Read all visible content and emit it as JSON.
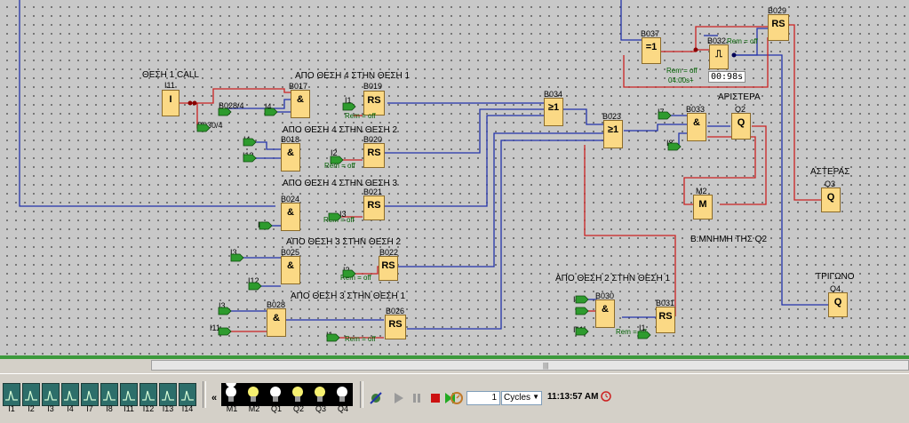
{
  "diagram": {
    "titles": {
      "call": "ΘΕΣΗ 1 CALL",
      "r1": "ΑΠΟ ΘΕΣΗ 4 ΣΤΗΝ ΘΕΣΗ 1",
      "r2": "ΑΠΟ ΘΕΣΗ 4 ΣΤΗΝ ΘΕΣΗ 2",
      "r3": "ΑΠΟ ΘΕΣΗ 4 ΣΤΗΝ ΘΕΣΗ 3",
      "r4": "ΑΠΟ ΘΕΣΗ 3 ΣΤΗΝ ΘΕΣΗ 2",
      "r5": "ΑΠΟ ΘΕΣΗ 3 ΣΤΗΝ ΘΕΣΗ 1",
      "r6": "ΑΠΟ ΘΕΣΗ 2 ΣΤΗΝ ΘΕΣΗ 1",
      "aristera": "ΑΡΙΣΤΕΡΑ",
      "asteras": "ΑΣΤΕΡΑΣ",
      "trigono": "ΤΡΙΓΩΝΟ",
      "mnimi": "Β:ΜΝΗΜΗ ΤΗΣ Q2"
    },
    "blocks": {
      "I11": {
        "id": "I11",
        "text": "I"
      },
      "B017": {
        "id": "B017",
        "text": "&"
      },
      "B019": {
        "id": "B019",
        "text": "RS"
      },
      "B018": {
        "id": "B018",
        "text": "&"
      },
      "B020": {
        "id": "B020",
        "text": "RS"
      },
      "B024": {
        "id": "B024",
        "text": "&"
      },
      "B021": {
        "id": "B021",
        "text": "RS"
      },
      "B025": {
        "id": "B025",
        "text": "&"
      },
      "B022": {
        "id": "B022",
        "text": "RS"
      },
      "B028": {
        "id": "B028",
        "text": "&"
      },
      "B026": {
        "id": "B026",
        "text": "RS"
      },
      "B034": {
        "id": "B034",
        "text": "≥1"
      },
      "B023": {
        "id": "B023",
        "text": "≥1"
      },
      "B037": {
        "id": "B037",
        "text": "=1"
      },
      "B032": {
        "id": "B032",
        "text": "⎍"
      },
      "B029": {
        "id": "B029",
        "text": "RS"
      },
      "B033": {
        "id": "B033",
        "text": "&"
      },
      "Q2": {
        "id": "Q2",
        "text": "Q"
      },
      "M2": {
        "id": "M2",
        "text": "M"
      },
      "Q3": {
        "id": "Q3",
        "text": "Q"
      },
      "Q4": {
        "id": "Q4",
        "text": "Q"
      },
      "B030": {
        "id": "B030",
        "text": "&"
      },
      "B031": {
        "id": "B031",
        "text": "RS"
      }
    },
    "inputs": {
      "B028_4": "B028/4",
      "B030_4": "B030/4",
      "i4a": "I4",
      "i1a": "I1",
      "i4b": "I4",
      "i12a": "I12",
      "i2a": "I2",
      "i13": "I13",
      "i3a": "I3",
      "i3b": "I3",
      "i12b": "I12",
      "i2b": "I2",
      "i3c": "I3",
      "i11a": "I11",
      "i1b": "I1",
      "i7": "I7",
      "i8": "I8",
      "i2c": "I2",
      "i11b": "I11",
      "i1c": "I1"
    },
    "rem_text": "Rem = off",
    "rem_timer": "Rem = off",
    "timer_on": "04:00s+",
    "timer_value": "00:98s"
  },
  "toolbar": {
    "inputs": [
      "I1",
      "I2",
      "I3",
      "I4",
      "I7",
      "I8",
      "I11",
      "I12",
      "I13",
      "I14"
    ],
    "collapse": "«",
    "outputs": [
      {
        "label": "M1",
        "state": "off"
      },
      {
        "label": "M2",
        "state": "on"
      },
      {
        "label": "Q1",
        "state": "off"
      },
      {
        "label": "Q2",
        "state": "on"
      },
      {
        "label": "Q3",
        "state": "on"
      },
      {
        "label": "Q4",
        "state": "off"
      }
    ],
    "cycles_value": "1",
    "cycles_unit": "Cycles",
    "time": "11:13:57 AM"
  },
  "colors": {
    "block_fill": "#fbd985",
    "wire_blue": "#2233aa",
    "wire_red": "#cc2222",
    "input_green": "#2e9b2e"
  }
}
